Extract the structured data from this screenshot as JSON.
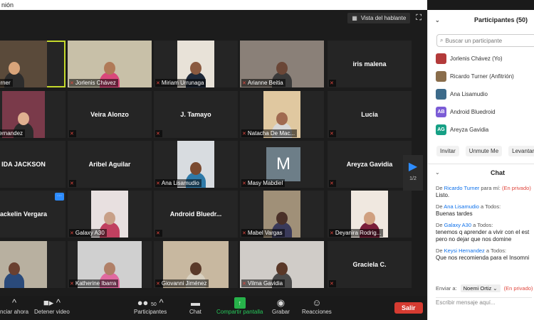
{
  "window": {
    "title": "nión"
  },
  "video": {
    "view_label": "Vista del hablante",
    "page_indicator": "1/2",
    "tiles": [
      {
        "name": "o Turner",
        "big": ""
      },
      {
        "name": "Jorlenis Chávez",
        "big": ""
      },
      {
        "name": "Miriam Urrunaga",
        "big": ""
      },
      {
        "name": "Arianne Beitia",
        "big": ""
      },
      {
        "name": "",
        "big": "iris malena"
      },
      {
        "name": "si Hernandez",
        "big": ""
      },
      {
        "name": "",
        "big": "Veira Alonzo"
      },
      {
        "name": "",
        "big": "J. Tamayo"
      },
      {
        "name": "Natacha De Mac...",
        "big": ""
      },
      {
        "name": "",
        "big": "Lucia"
      },
      {
        "name": "",
        "big": "IDA JACKSON"
      },
      {
        "name": "",
        "big": "Aribel Aguilar"
      },
      {
        "name": "Ana Lisamudio",
        "big": ""
      },
      {
        "name": "Masy Mabdiel",
        "big": ""
      },
      {
        "name": "",
        "big": "Areyza Gavidia"
      },
      {
        "name": "",
        "big": "ackelin Vergara"
      },
      {
        "name": "Galaxy A30",
        "big": ""
      },
      {
        "name": "",
        "big": "Android  Bluedr..."
      },
      {
        "name": "Mabel Vargas",
        "big": ""
      },
      {
        "name": "Deyanira Rodrig...",
        "big": ""
      },
      {
        "name": "a",
        "big": ""
      },
      {
        "name": "Katherine Ibarra",
        "big": ""
      },
      {
        "name": "Giovanni Jiménez",
        "big": ""
      },
      {
        "name": "Vilma Gavidia",
        "big": ""
      },
      {
        "name": "",
        "big": "Graciela C."
      }
    ],
    "m_avatar_letter": "M"
  },
  "toolbar": {
    "start_video": "nciar ahora",
    "stop_video": "Detener video",
    "participants": "Participantes",
    "participants_count": "50",
    "chat": "Chat",
    "share": "Compartir pantalla",
    "record": "Grabar",
    "reactions": "Reacciones",
    "leave": "Salir"
  },
  "participants_panel": {
    "title": "Participantes (50)",
    "search_placeholder": "Buscar un participante",
    "items": [
      {
        "name": "Jorlenis Chávez (Yo)",
        "avatar": "",
        "color": "#b33a3a"
      },
      {
        "name": "Ricardo Turner (Anfitrión)",
        "avatar": "",
        "color": "#8a6d4b"
      },
      {
        "name": "Ana Lisamudio",
        "avatar": "",
        "color": "#3d6b8a"
      },
      {
        "name": "Android Bluedroid",
        "avatar": "AB",
        "color": "#7b5cd6"
      },
      {
        "name": "Areyza Gavidia",
        "avatar": "AG",
        "color": "#16a085"
      }
    ],
    "buttons": [
      "Invitar",
      "Unmute Me",
      "Levantar"
    ]
  },
  "chat_panel": {
    "title": "Chat",
    "messages": [
      {
        "prefix": "De",
        "from": "Ricardo Turner",
        "to": "para mí:",
        "private": "(En privado)",
        "text": "Listo."
      },
      {
        "prefix": "De",
        "from": "Ana Lisamudio",
        "to": "a Todos:",
        "private": "",
        "text": "Buenas tardes"
      },
      {
        "prefix": "De",
        "from": "Galaxy A30",
        "to": "a Todos:",
        "private": "",
        "text": "tenemos q aprender a vivir con el est",
        "text2": "pero no dejar que nos domine"
      },
      {
        "prefix": "De",
        "from": "Keysi Hernandez",
        "to": "a Todos:",
        "private": "",
        "text": "Que nos recomienda para el Insomni"
      }
    ],
    "send_to_label": "Enviar a:",
    "send_to_value": "Noemi Ortiz",
    "send_to_private": "(En privado)",
    "compose_placeholder": "Escribir mensaje aquí..."
  }
}
